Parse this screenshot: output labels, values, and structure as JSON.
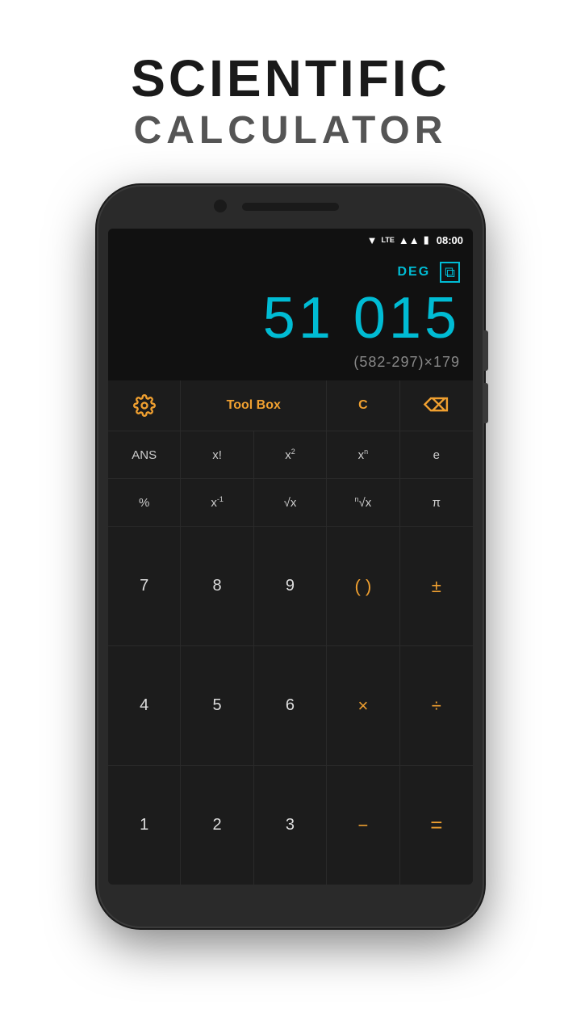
{
  "header": {
    "line1": "SCIENTIFIC",
    "line2": "CALCULATOR"
  },
  "status_bar": {
    "time": "08:00",
    "deg": "DEG"
  },
  "display": {
    "result": "51 015",
    "formula": "(582-297)×179",
    "deg_label": "DEG"
  },
  "toolbar": {
    "toolbox_label": "Tool Box",
    "clear_label": "C"
  },
  "scientific_row1": {
    "ans": "ANS",
    "factorial": "x!",
    "x2": "x²",
    "xn": "xⁿ",
    "e": "e"
  },
  "scientific_row2": {
    "percent": "%",
    "xinv": "x⁻¹",
    "sqrt": "√x",
    "nthroot": "ⁿ√x",
    "pi": "π"
  },
  "num_rows": [
    [
      "7",
      "8",
      "9",
      "( )",
      "±"
    ],
    [
      "4",
      "5",
      "6",
      "×",
      "÷"
    ],
    [
      "1",
      "2",
      "3",
      "-",
      "="
    ]
  ]
}
